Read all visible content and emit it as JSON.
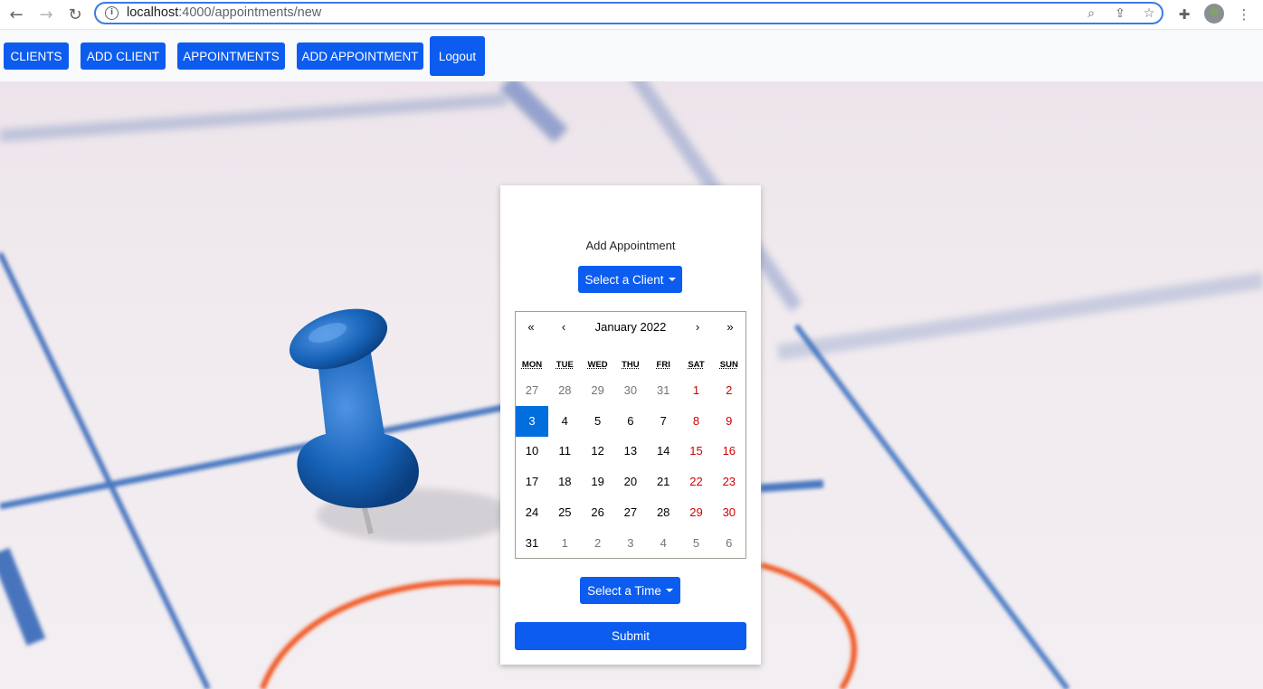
{
  "browser": {
    "url_host": "localhost",
    "url_path": ":4000/appointments/new"
  },
  "nav": {
    "items": [
      {
        "label": "CLIENTS"
      },
      {
        "label": "ADD CLIENT"
      },
      {
        "label": "APPOINTMENTS"
      },
      {
        "label": "ADD APPOINTMENT"
      },
      {
        "label": "Logout"
      }
    ]
  },
  "form": {
    "title": "Add Appointment",
    "client_select_label": "Select a Client",
    "time_select_label": "Select a Time",
    "submit_label": "Submit"
  },
  "calendar": {
    "prev_year": "«",
    "prev_month": "‹",
    "month_label": "January 2022",
    "next_month": "›",
    "next_year": "»",
    "weekdays": [
      "MON",
      "TUE",
      "WED",
      "THU",
      "FRI",
      "SAT",
      "SUN"
    ],
    "days": [
      {
        "d": "27",
        "type": "neighbor"
      },
      {
        "d": "28",
        "type": "neighbor"
      },
      {
        "d": "29",
        "type": "neighbor"
      },
      {
        "d": "30",
        "type": "neighbor"
      },
      {
        "d": "31",
        "type": "neighbor"
      },
      {
        "d": "1",
        "type": "weekend"
      },
      {
        "d": "2",
        "type": "weekend"
      },
      {
        "d": "3",
        "type": "active"
      },
      {
        "d": "4",
        "type": ""
      },
      {
        "d": "5",
        "type": ""
      },
      {
        "d": "6",
        "type": ""
      },
      {
        "d": "7",
        "type": ""
      },
      {
        "d": "8",
        "type": "weekend"
      },
      {
        "d": "9",
        "type": "weekend"
      },
      {
        "d": "10",
        "type": ""
      },
      {
        "d": "11",
        "type": ""
      },
      {
        "d": "12",
        "type": ""
      },
      {
        "d": "13",
        "type": ""
      },
      {
        "d": "14",
        "type": ""
      },
      {
        "d": "15",
        "type": "weekend"
      },
      {
        "d": "16",
        "type": "weekend"
      },
      {
        "d": "17",
        "type": ""
      },
      {
        "d": "18",
        "type": ""
      },
      {
        "d": "19",
        "type": ""
      },
      {
        "d": "20",
        "type": ""
      },
      {
        "d": "21",
        "type": ""
      },
      {
        "d": "22",
        "type": "weekend"
      },
      {
        "d": "23",
        "type": "weekend"
      },
      {
        "d": "24",
        "type": ""
      },
      {
        "d": "25",
        "type": ""
      },
      {
        "d": "26",
        "type": ""
      },
      {
        "d": "27",
        "type": ""
      },
      {
        "d": "28",
        "type": ""
      },
      {
        "d": "29",
        "type": "weekend"
      },
      {
        "d": "30",
        "type": "weekend"
      },
      {
        "d": "31",
        "type": ""
      },
      {
        "d": "1",
        "type": "neighbor"
      },
      {
        "d": "2",
        "type": "neighbor"
      },
      {
        "d": "3",
        "type": "neighbor"
      },
      {
        "d": "4",
        "type": "neighbor"
      },
      {
        "d": "5",
        "type": "neighbor"
      },
      {
        "d": "6",
        "type": "neighbor"
      }
    ]
  },
  "colors": {
    "primary": "#0d5cf0",
    "active_day": "#006edc",
    "weekend": "#d10000"
  }
}
